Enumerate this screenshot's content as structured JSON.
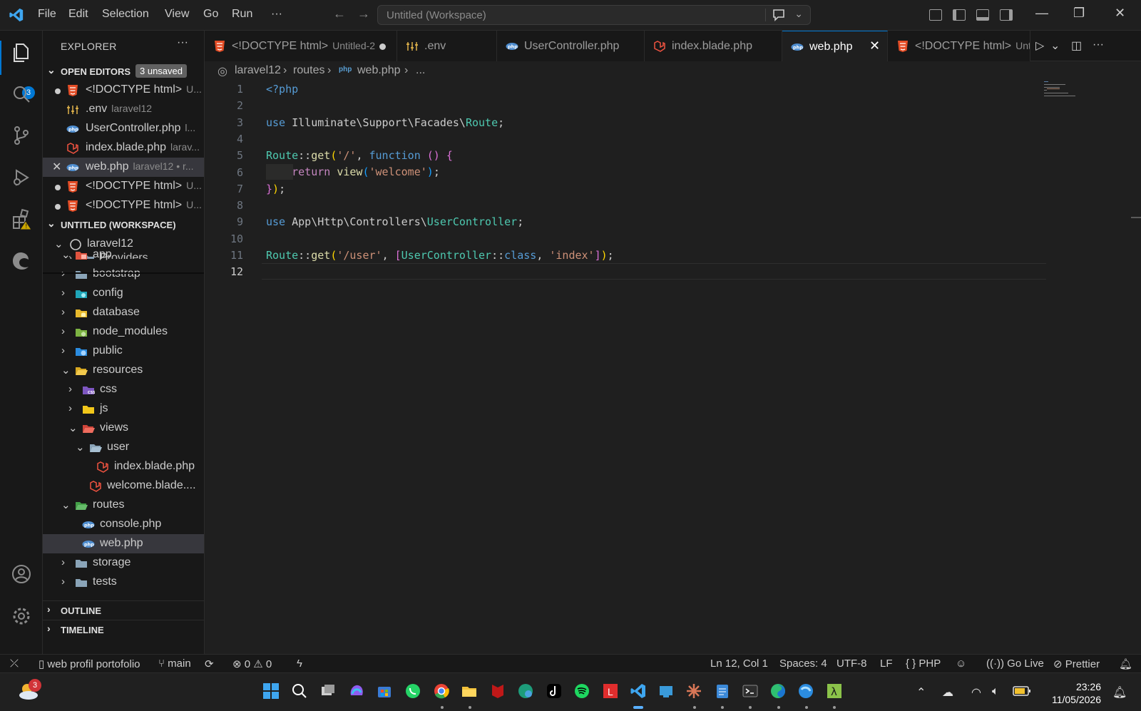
{
  "menu": [
    "File",
    "Edit",
    "Selection",
    "View",
    "Go",
    "Run",
    "···"
  ],
  "command_center": {
    "placeholder": "Untitled (Workspace)"
  },
  "activity": {
    "explorer_badge": "3"
  },
  "sidebar": {
    "title": "EXPLORER",
    "more": "···",
    "open_editors": {
      "label": "OPEN EDITORS",
      "badge": "3 unsaved",
      "items": [
        {
          "name": "<!DOCTYPE html>",
          "desc": "U...",
          "state": "modified",
          "icon": "html-icon"
        },
        {
          "name": ".env",
          "desc": "laravel12",
          "state": "none",
          "icon": "env-icon"
        },
        {
          "name": "UserController.php",
          "desc": "l...",
          "state": "none",
          "icon": "php-icon"
        },
        {
          "name": "index.blade.php",
          "desc": "larav...",
          "state": "none",
          "icon": "laravel-icon"
        },
        {
          "name": "web.php",
          "desc": "laravel12 • r...",
          "state": "active",
          "icon": "php-icon"
        },
        {
          "name": "<!DOCTYPE html>",
          "desc": "U...",
          "state": "modified",
          "icon": "html-icon"
        },
        {
          "name": "<!DOCTYPE html>",
          "desc": "U...",
          "state": "modified",
          "icon": "html-icon"
        }
      ]
    },
    "workspace": {
      "label": "UNTITLED (WORKSPACE)",
      "root": "laravel12",
      "tree": [
        {
          "name": "Providers",
          "depth": 2,
          "open": false,
          "icon": "folder-icon"
        },
        {
          "name": "app",
          "depth": 1,
          "open": true,
          "icon": "app-folder-icon"
        },
        {
          "name": "bootstrap",
          "depth": 1,
          "open": false,
          "icon": "folder-icon"
        },
        {
          "name": "config",
          "depth": 1,
          "open": false,
          "icon": "config-folder-icon"
        },
        {
          "name": "database",
          "depth": 1,
          "open": false,
          "icon": "database-folder-icon"
        },
        {
          "name": "node_modules",
          "depth": 1,
          "open": false,
          "icon": "node-folder-icon"
        },
        {
          "name": "public",
          "depth": 1,
          "open": false,
          "icon": "public-folder-icon"
        },
        {
          "name": "resources",
          "depth": 1,
          "open": true,
          "icon": "resources-folder-icon"
        },
        {
          "name": "css",
          "depth": 2,
          "open": false,
          "icon": "css-folder-icon"
        },
        {
          "name": "js",
          "depth": 2,
          "open": false,
          "icon": "js-folder-icon"
        },
        {
          "name": "views",
          "depth": 2,
          "open": true,
          "icon": "views-folder-icon"
        },
        {
          "name": "user",
          "depth": 3,
          "open": true,
          "icon": "folder-open-icon"
        },
        {
          "name": "index.blade.php",
          "depth": 4,
          "open": null,
          "icon": "laravel-icon"
        },
        {
          "name": "welcome.blade....",
          "depth": 3,
          "open": null,
          "icon": "laravel-icon"
        },
        {
          "name": "routes",
          "depth": 1,
          "open": true,
          "icon": "routes-folder-icon"
        },
        {
          "name": "console.php",
          "depth": 2,
          "open": null,
          "icon": "php-icon"
        },
        {
          "name": "web.php",
          "depth": 2,
          "open": null,
          "icon": "php-icon"
        },
        {
          "name": "storage",
          "depth": 1,
          "open": false,
          "icon": "folder-icon"
        },
        {
          "name": "tests",
          "depth": 1,
          "open": false,
          "icon": "folder-icon"
        }
      ]
    },
    "outline": "OUTLINE",
    "timeline": "TIMELINE"
  },
  "tabs": [
    {
      "name": "<!DOCTYPE html>",
      "desc": "Untitled-2",
      "icon": "html-icon",
      "modified": true
    },
    {
      "name": ".env",
      "desc": "",
      "icon": "env-icon",
      "modified": false
    },
    {
      "name": "UserController.php",
      "desc": "",
      "icon": "php-icon",
      "modified": false
    },
    {
      "name": "index.blade.php",
      "desc": "",
      "icon": "laravel-icon",
      "modified": false
    },
    {
      "name": "web.php",
      "desc": "",
      "icon": "php-icon",
      "active": true
    },
    {
      "name": "<!DOCTYPE html>",
      "desc": "Unt",
      "icon": "html-icon",
      "modified": false
    }
  ],
  "breadcrumb": [
    "laravel12",
    "routes",
    "web.php",
    "..."
  ],
  "code": {
    "line_numbers": [
      "1",
      "2",
      "3",
      "4",
      "5",
      "6",
      "7",
      "8",
      "9",
      "10",
      "11",
      "12"
    ],
    "current_line": "12"
  },
  "status": {
    "remote": "",
    "project": "web profil portofolio",
    "branch": "main",
    "errors": "0",
    "warnings": "0",
    "position": "Ln 12, Col 1",
    "spaces": "Spaces: 4",
    "encoding": "UTF-8",
    "eol": "LF",
    "language": "PHP",
    "golive": "Go Live",
    "prettier": "Prettier"
  },
  "taskbar": {
    "weather_badge": "3",
    "time": "23:26",
    "date": "11/05/2026"
  },
  "colors": {
    "accent": "#0078d4",
    "bg": "#1f1f1f",
    "sidebar": "#181818"
  }
}
